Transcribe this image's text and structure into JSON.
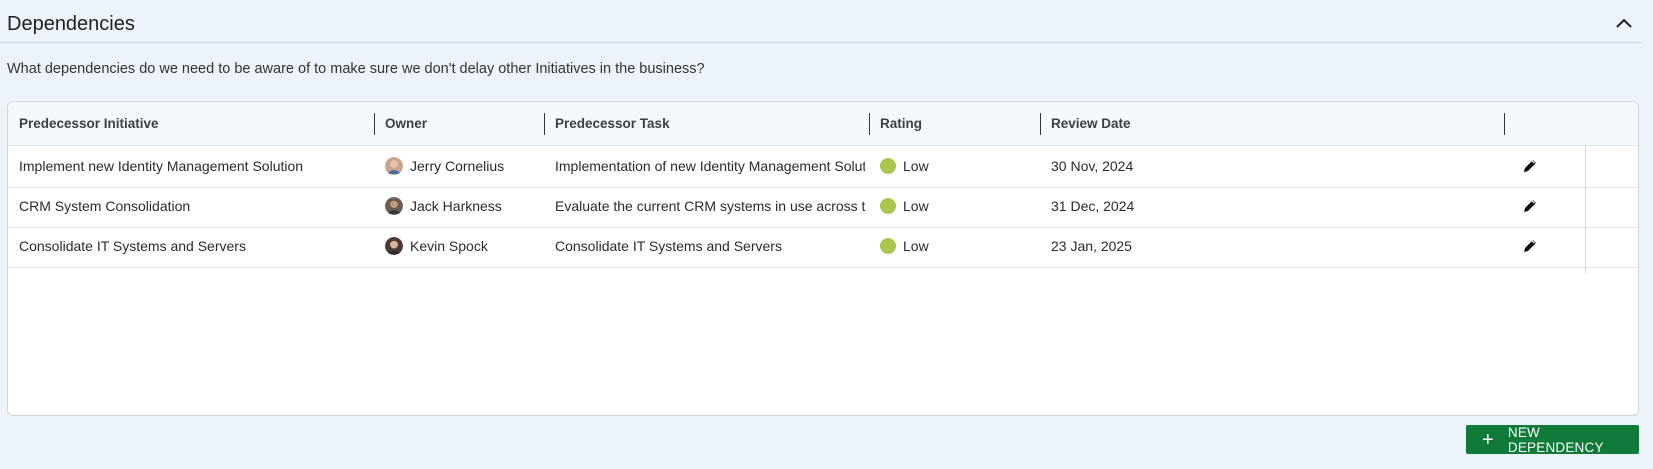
{
  "section": {
    "title": "Dependencies",
    "question": "What dependencies do we need to be aware of to make sure we don't delay other Initiatives in the business?"
  },
  "table": {
    "columns": [
      "Predecessor Initiative",
      "Owner",
      "Predecessor Task",
      "Rating",
      "Review Date"
    ],
    "rows": [
      {
        "initiative": "Implement new Identity Management Solution",
        "owner": "Jerry Cornelius",
        "task": "Implementation of new Identity Management Solution",
        "rating": "Low",
        "review_date": "30 Nov, 2024"
      },
      {
        "initiative": "CRM System Consolidation",
        "owner": "Jack Harkness",
        "task": "Evaluate the current CRM systems in use across the ...",
        "rating": "Low",
        "review_date": "31 Dec, 2024"
      },
      {
        "initiative": "Consolidate IT Systems and Servers",
        "owner": "Kevin Spock",
        "task": "Consolidate IT Systems and Servers",
        "rating": "Low",
        "review_date": "23 Jan, 2025"
      }
    ]
  },
  "actions": {
    "new_dependency_label": "NEW DEPENDENCY"
  },
  "colors": {
    "accent_button": "#0f7a3a",
    "rating_low": "#a9c84f",
    "background": "#edf3fb"
  },
  "icons": {
    "collapse": "chevron-up-icon",
    "edit": "pencil-icon",
    "add": "plus-icon"
  }
}
